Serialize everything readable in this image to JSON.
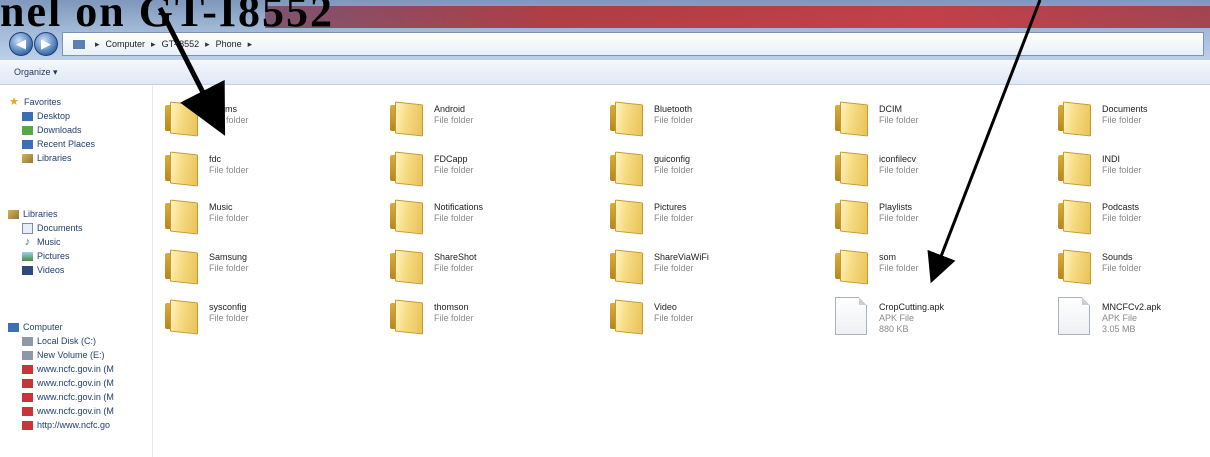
{
  "caption": {
    "text": "nel on GT-I8552"
  },
  "address": {
    "crumbs": [
      "Computer",
      "GT-I8552",
      "Phone"
    ]
  },
  "toolbar": {
    "organize_label": "Organize ▾"
  },
  "nav": {
    "favorites_header": "Favorites",
    "favorites": [
      "Desktop",
      "Downloads",
      "Recent Places",
      "Libraries"
    ],
    "libraries_header": "Libraries",
    "libraries": [
      "Documents",
      "Music",
      "Pictures",
      "Videos"
    ],
    "computer_header": "Computer",
    "computer": [
      "Local Disk (C:)",
      "New Volume (E:)",
      "www.ncfc.gov.in (M",
      "www.ncfc.gov.in (M",
      "www.ncfc.gov.in (M",
      "www.ncfc.gov.in (M",
      "http://www.ncfc.go"
    ]
  },
  "files": [
    {
      "name": "Alarms",
      "type": "File folder",
      "kind": "folder"
    },
    {
      "name": "Android",
      "type": "File folder",
      "kind": "folder"
    },
    {
      "name": "Bluetooth",
      "type": "File folder",
      "kind": "folder"
    },
    {
      "name": "DCIM",
      "type": "File folder",
      "kind": "folder"
    },
    {
      "name": "Documents",
      "type": "File folder",
      "kind": "folder"
    },
    {
      "name": "fdc",
      "type": "File folder",
      "kind": "folder"
    },
    {
      "name": "FDCapp",
      "type": "File folder",
      "kind": "folder"
    },
    {
      "name": "guiconfig",
      "type": "File folder",
      "kind": "folder"
    },
    {
      "name": "iconfilecv",
      "type": "File folder",
      "kind": "folder"
    },
    {
      "name": "INDI",
      "type": "File folder",
      "kind": "folder"
    },
    {
      "name": "Music",
      "type": "File folder",
      "kind": "folder"
    },
    {
      "name": "Notifications",
      "type": "File folder",
      "kind": "folder"
    },
    {
      "name": "Pictures",
      "type": "File folder",
      "kind": "folder"
    },
    {
      "name": "Playlists",
      "type": "File folder",
      "kind": "folder"
    },
    {
      "name": "Podcasts",
      "type": "File folder",
      "kind": "folder"
    },
    {
      "name": "Samsung",
      "type": "File folder",
      "kind": "folder"
    },
    {
      "name": "ShareShot",
      "type": "File folder",
      "kind": "folder"
    },
    {
      "name": "ShareViaWiFi",
      "type": "File folder",
      "kind": "folder"
    },
    {
      "name": "som",
      "type": "File folder",
      "kind": "folder"
    },
    {
      "name": "Sounds",
      "type": "File folder",
      "kind": "folder"
    },
    {
      "name": "sysconfig",
      "type": "File folder",
      "kind": "folder"
    },
    {
      "name": "thomson",
      "type": "File folder",
      "kind": "folder"
    },
    {
      "name": "Video",
      "type": "File folder",
      "kind": "folder"
    },
    {
      "name": "CropCutting.apk",
      "type": "APK File",
      "size": "880 KB",
      "kind": "file"
    },
    {
      "name": "MNCFCv2.apk",
      "type": "APK File",
      "size": "3.05 MB",
      "kind": "file"
    }
  ],
  "colors": {
    "arrow": "#000000",
    "titlebar_red": "#c8343a"
  },
  "icons": {
    "folder": "folder-icon",
    "file": "apk-file-icon"
  }
}
